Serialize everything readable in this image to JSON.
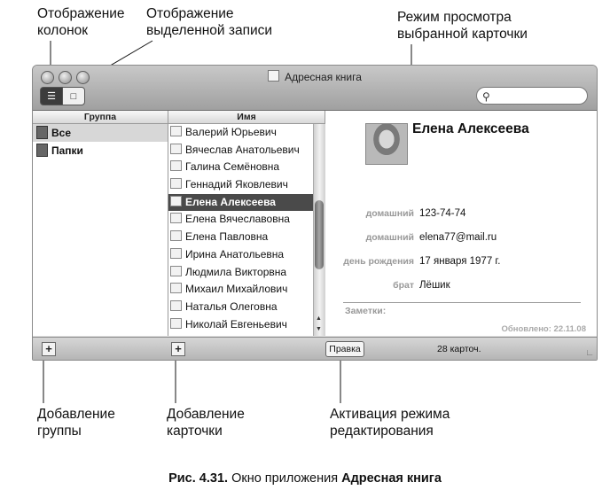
{
  "callouts": {
    "columns_view": "Отображение колонок",
    "selected_record_view": "Отображение выделенной записи",
    "card_view_mode": "Режим просмотра выбранной карточки",
    "add_group": "Добавление группы",
    "add_card": "Добавление карточки",
    "edit_mode": "Активация режима редактирования"
  },
  "window": {
    "title": "Адресная книга",
    "search_placeholder": "",
    "group_header": "Группа",
    "name_header": "Имя",
    "groups": [
      {
        "label": "Все",
        "selected": true
      },
      {
        "label": "Папки",
        "selected": false
      }
    ],
    "names": [
      "Валерий Юрьевич",
      "Вячеслав Анатольевич",
      "Галина Семёновна",
      "Геннадий Яковлевич",
      "Елена Алексеева",
      "Елена Вячеславовна",
      "Елена Павловна",
      "Ирина Анатольевна",
      "Людмила Викторвна",
      "Михаил Михайлович",
      "Наталья Олеговна",
      "Николай Евгеньевич"
    ],
    "selected_name_index": 4,
    "card": {
      "name": "Елена Алексеева",
      "fields": [
        {
          "label": "домашний",
          "value": "123-74-74"
        },
        {
          "label": "домашний",
          "value": "elena77@mail.ru"
        },
        {
          "label": "день рождения",
          "value": "17 января 1977 г."
        },
        {
          "label": "брат",
          "value": "Лёшик"
        }
      ],
      "notes_label": "Заметки:",
      "updated": "Обновлено: 22.11.08"
    },
    "add_symbol": "+",
    "edit_button": "Правка",
    "card_count": "28 карточ."
  },
  "caption": {
    "prefix": "Рис. 4.31.",
    "text": " Окно приложения ",
    "app": "Адресная книга"
  }
}
